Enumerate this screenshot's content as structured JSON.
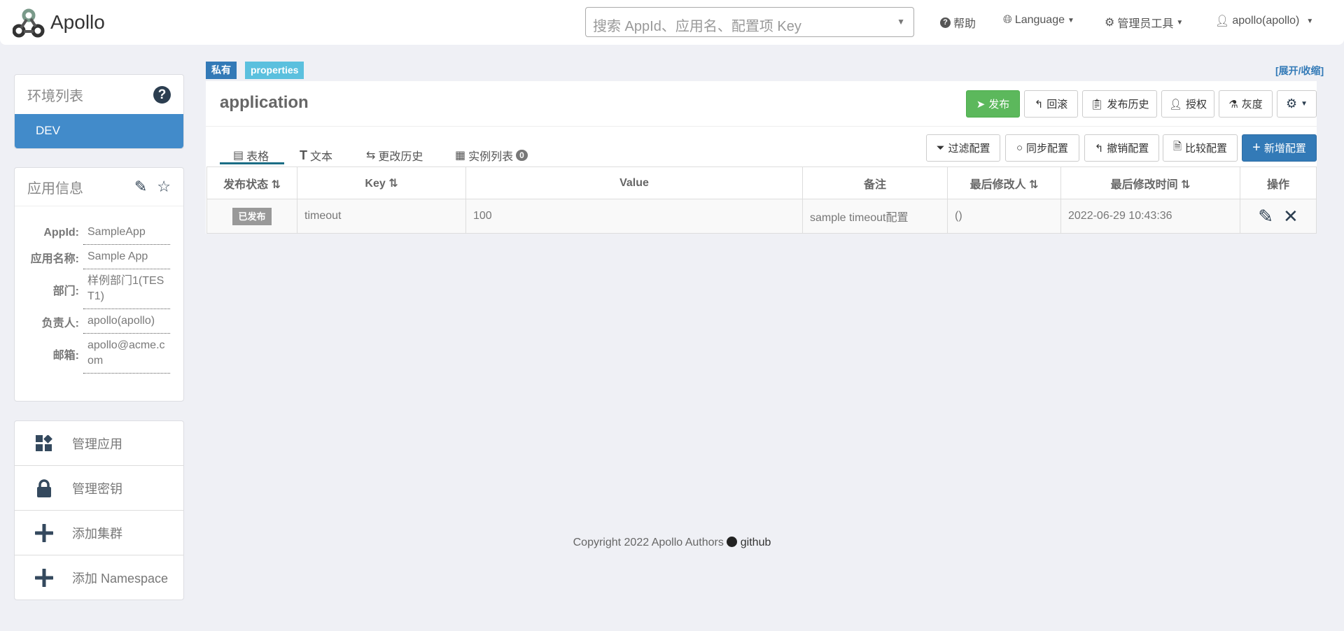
{
  "header": {
    "logo": "Apollo",
    "search_placeholder": "搜索 AppId、应用名、配置项 Key",
    "help": "帮助",
    "language": "Language",
    "admin_tools": "管理员工具",
    "user": "apollo(apollo)"
  },
  "env_panel": {
    "title": "环境列表",
    "envs": [
      "DEV"
    ]
  },
  "app_info": {
    "title": "应用信息",
    "fields": [
      {
        "label": "AppId:",
        "value": "SampleApp"
      },
      {
        "label": "应用名称:",
        "value": "Sample App"
      },
      {
        "label": "部门:",
        "value": "样例部门1(TEST1)"
      },
      {
        "label": "负责人:",
        "value": "apollo(apollo)"
      },
      {
        "label": "邮箱:",
        "value": "apollo@acme.com"
      }
    ]
  },
  "menu": [
    "管理应用",
    "管理密钥",
    "添加集群",
    "添加 Namespace"
  ],
  "namespace": {
    "badge_private": "私有",
    "badge_format": "properties",
    "toggle": "[展开/收缩]",
    "name": "application",
    "actions": [
      "发布",
      "回滚",
      "发布历史",
      "授权",
      "灰度"
    ],
    "tabs": [
      "表格",
      "文本",
      "更改历史",
      "实例列表"
    ],
    "instance_count": "0",
    "table_actions": [
      "过滤配置",
      "同步配置",
      "撤销配置",
      "比较配置",
      "新增配置"
    ],
    "columns": [
      "发布状态",
      "Key",
      "Value",
      "备注",
      "最后修改人",
      "最后修改时间",
      "操作"
    ],
    "rows": [
      {
        "status": "已发布",
        "key": "timeout",
        "value": "100",
        "comment": "sample timeout配置",
        "modifier": "()",
        "time": "2022-06-29 10:43:36"
      }
    ]
  },
  "footer": {
    "copyright": "Copyright 2022 Apollo Authors",
    "github": "github"
  },
  "colors": {
    "primary": "#3c8dd0",
    "success": "#5cb85c",
    "info": "#5bc0de",
    "badge_private": "#337ab7",
    "dark_icon": "#34495e"
  }
}
